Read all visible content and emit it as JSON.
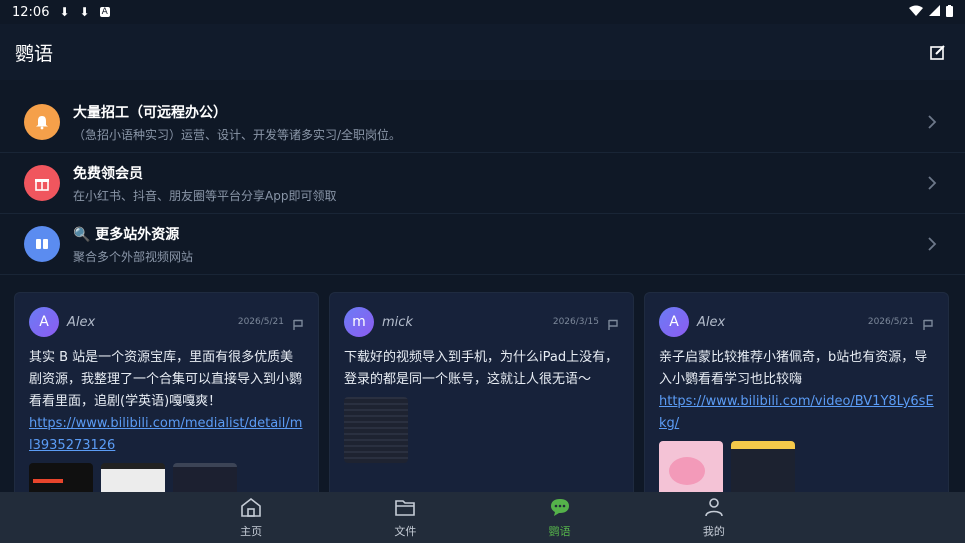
{
  "status": {
    "time": "12:06"
  },
  "app": {
    "title": "鹦语"
  },
  "promos": [
    {
      "title": "大量招工（可远程办公）",
      "subtitle": "（急招小语种实习）运营、设计、开发等诸多实习/全职岗位。",
      "icon": "bell-icon",
      "color": "#f5a04a"
    },
    {
      "title": "免费领会员",
      "subtitle": "在小红书、抖音、朋友圈等平台分享App即可领取",
      "icon": "gift-icon",
      "color": "#f0565e"
    },
    {
      "title": "🔍 更多站外资源",
      "subtitle": "聚合多个外部视频网站",
      "icon": "book-icon",
      "color": "#5b8cf0"
    }
  ],
  "posts": [
    {
      "avatar": "A",
      "user": "Alex",
      "date": "2026/5/21",
      "text": "其实 B 站是一个资源宝库，里面有很多优质美剧资源，我整理了一个合集可以直接导入到小鹦看看里面，追剧(学英语)嘎嘎爽！",
      "link": "https://www.bilibili.com/medialist/detail/ml3935273126"
    },
    {
      "avatar": "m",
      "user": "mick",
      "date": "2026/3/15",
      "text": "下载好的视频导入到手机，为什么iPad上没有，登录的都是同一个账号，这就让人很无语～",
      "link": ""
    },
    {
      "avatar": "A",
      "user": "Alex",
      "date": "2026/5/21",
      "text": "亲子启蒙比较推荐小猪佩奇，b站也有资源，导入小鹦看看学习也比较嗨",
      "link": "https://www.bilibili.com/video/BV1Y8Ly6sEkg/"
    }
  ],
  "nav": [
    {
      "label": "主页",
      "icon": "home-icon"
    },
    {
      "label": "文件",
      "icon": "folder-icon"
    },
    {
      "label": "鹦语",
      "icon": "chat-icon"
    },
    {
      "label": "我的",
      "icon": "profile-icon"
    }
  ],
  "colors": {
    "accent": "#55b24a",
    "link": "#5b9cf5",
    "background": "#0f1826"
  }
}
